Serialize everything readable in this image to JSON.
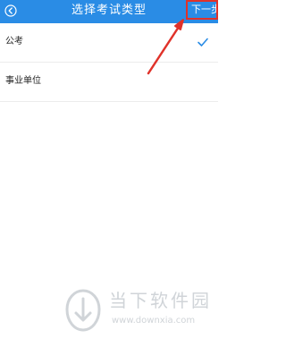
{
  "header": {
    "title": "选择考试类型",
    "next_label": "下一步",
    "back_icon": "back-arrow-icon",
    "background_color": "#2a8ce5"
  },
  "exam_types": [
    {
      "label": "公考",
      "selected": true
    },
    {
      "label": "事业单位",
      "selected": false
    }
  ],
  "annotation": {
    "arrow_color": "#e0322a",
    "highlight_color": "#e0322a"
  },
  "watermark": {
    "title": "当下软件园",
    "url": "www.downxia.com",
    "color": "#d0d4d8"
  }
}
